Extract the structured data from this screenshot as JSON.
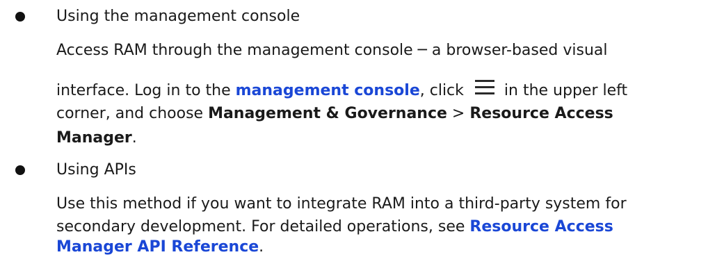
{
  "items": [
    {
      "heading": "Using the management console",
      "line1": "Access RAM through the management console ─ a browser-based visual",
      "line2_pre": "interface. Log in to the ",
      "line2_link": "management console",
      "line2_mid": ", click",
      "line2_post": "in the upper left",
      "line3_pre": "corner, and choose ",
      "line3_bold1": "Management & Governance",
      "line3_sep": " > ",
      "line3_bold2": "Resource Access",
      "line4_bold": "Manager",
      "line4_post": ".",
      "icon": "hamburger-menu-icon"
    },
    {
      "heading": "Using APIs",
      "line1": "Use this method if you want to integrate RAM into a third-party system for",
      "line2_pre": "secondary development. For detailed operations, see ",
      "line2_link": "Resource Access",
      "line3_link": "Manager API Reference",
      "line3_post": "."
    }
  ],
  "colors": {
    "text": "#1a1a1a",
    "link": "#1a47d6",
    "background": "#ffffff"
  }
}
